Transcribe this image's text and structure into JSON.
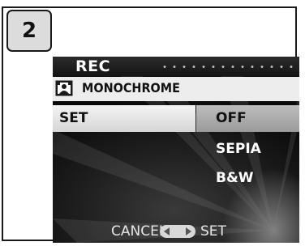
{
  "step": {
    "number": "2"
  },
  "screen": {
    "header": {
      "title": "REC"
    },
    "menu": {
      "item_label": "MONOCHROME",
      "icon": "monochrome-mode-icon"
    },
    "setting": {
      "label": "SET"
    },
    "options": [
      {
        "label": "OFF",
        "selected": true
      },
      {
        "label": "SEPIA",
        "selected": false
      },
      {
        "label": "B&W",
        "selected": false
      }
    ],
    "footer": {
      "cancel_label": "CANCEL",
      "set_label": "SET",
      "nav_icon": "left-right-dpad-icon"
    }
  },
  "colors": {
    "screen_background": "#1e1e1e",
    "highlight_bar": "#ededed",
    "selected_option": "#aaaaaa",
    "text_light": "#ffffff"
  }
}
